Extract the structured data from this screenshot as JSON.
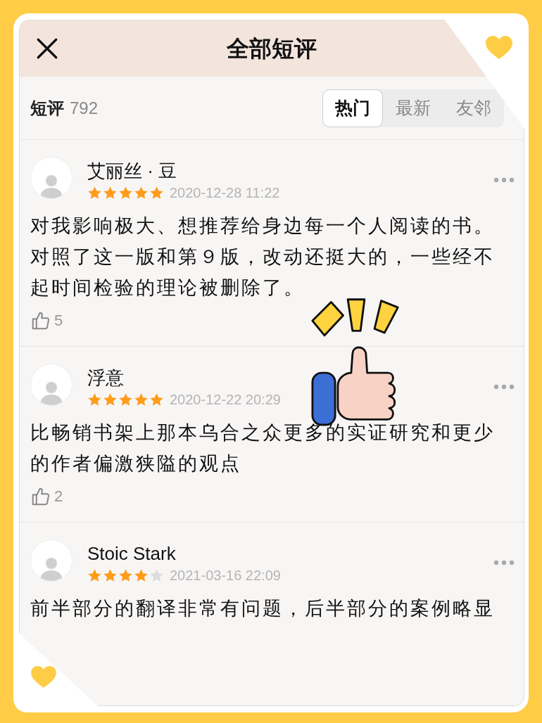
{
  "header": {
    "title": "全部短评"
  },
  "summary": {
    "label": "短评",
    "count": "792"
  },
  "tabs": [
    {
      "label": "热门",
      "selected": true
    },
    {
      "label": "最新",
      "selected": false
    },
    {
      "label": "友邻",
      "selected": false
    }
  ],
  "reviews": [
    {
      "name": "艾丽丝 · 豆",
      "stars": 5,
      "time": "2020-12-28 11:22",
      "text": "对我影响极大、想推荐给身边每一个人阅读的书。对照了这一版和第９版，改动还挺大的，一些经不起时间检验的理论被删除了。",
      "likes": "5"
    },
    {
      "name": "浮意",
      "stars": 5,
      "time": "2020-12-22 20:29",
      "text": "比畅销书架上那本乌合之众更多的实证研究和更少的作者偏激狭隘的观点",
      "likes": "2"
    },
    {
      "name": "Stoic Stark",
      "stars": 4,
      "time": "2021-03-16 22:09",
      "text": "前半部分的翻译非常有问题，后半部分的案例略显"
    }
  ]
}
